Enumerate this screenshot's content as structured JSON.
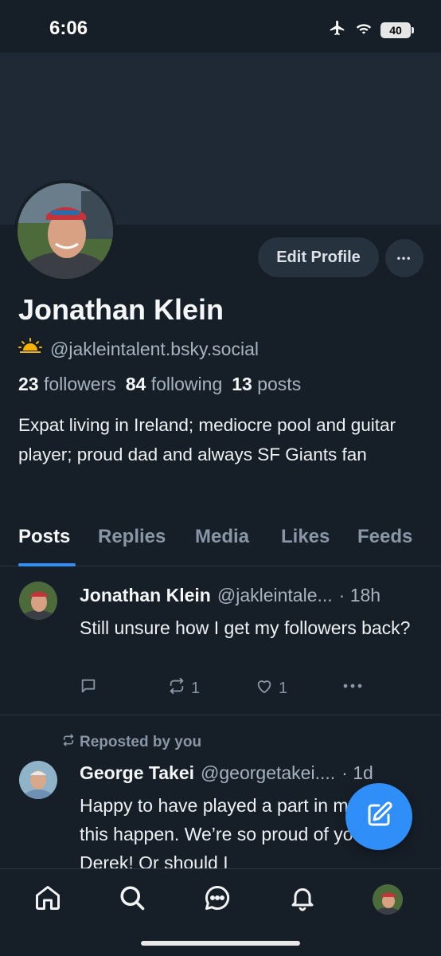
{
  "status_bar": {
    "time": "6:06",
    "battery": "40",
    "icons": [
      "airplane-icon",
      "wifi-icon",
      "battery-icon"
    ]
  },
  "profile": {
    "display_name": "Jonathan Klein",
    "handle": "@jakleintalent.bsky.social",
    "handle_icon": "sunrise-icon",
    "edit_profile_label": "Edit Profile",
    "more_label": "•••",
    "stats": {
      "followers_count": "23",
      "followers_label": "followers",
      "following_count": "84",
      "following_label": "following",
      "posts_count": "13",
      "posts_label": "posts"
    },
    "bio": "Expat living in Ireland; mediocre pool and guitar player; proud dad and always SF Giants fan"
  },
  "tabs": [
    {
      "label": "Posts",
      "active": true
    },
    {
      "label": "Replies",
      "active": false
    },
    {
      "label": "Media",
      "active": false
    },
    {
      "label": "Likes",
      "active": false
    },
    {
      "label": "Feeds",
      "active": false
    }
  ],
  "posts": [
    {
      "author": "Jonathan Klein",
      "handle": "@jakleintale...",
      "time": "· 18h",
      "text": "Still unsure how I get my followers back?",
      "reposts": "1",
      "likes": "1"
    },
    {
      "reposted_by": "Reposted by you",
      "author": "George Takei",
      "handle": "@georgetakei....",
      "time": "· 1d",
      "text": "Happy to have played a part in making this happen. We’re so proud of you, Derek! Or should I"
    }
  ],
  "colors": {
    "background": "#161e27",
    "banner": "#1f2935",
    "accent": "#2f8ef8",
    "muted_text": "#a7b3bf",
    "button_bg": "#27323f"
  },
  "bottom_nav": [
    "home-icon",
    "search-icon",
    "chat-icon",
    "bell-icon",
    "profile-avatar"
  ]
}
